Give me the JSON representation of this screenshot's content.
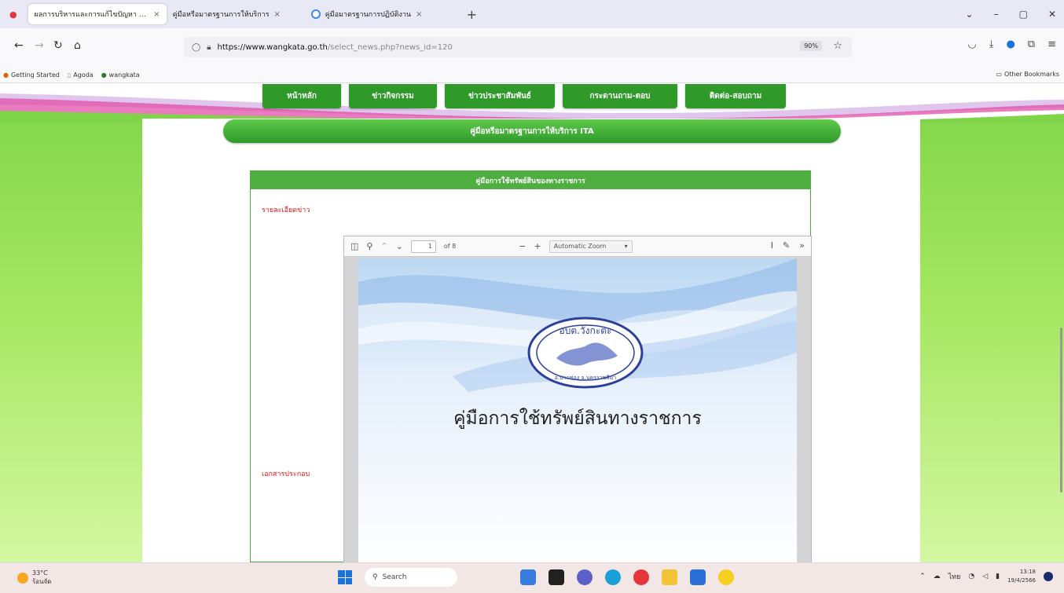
{
  "browser": {
    "tabs": [
      {
        "title": "ผลการบริหารและการแก้ไขปัญหา อบต.",
        "active": true
      },
      {
        "title": "คู่มือหรือมาตรฐานการให้บริการ",
        "active": false
      },
      {
        "title": "คู่มือมาตรฐานการปฏิบัติงาน",
        "active": false
      }
    ],
    "url_host": "https://www.wangkata.go.th",
    "url_rest": "/select_news.php?news_id=120",
    "zoom": "90%",
    "bookmarks": [
      "Getting Started",
      "Agoda",
      "wangkata"
    ],
    "other_bookmarks": "Other Bookmarks"
  },
  "site": {
    "menu": [
      "หน้าหลัก",
      "ข่าวกิจกรรม",
      "ข่าวประชาสัมพันธ์",
      "กระดานถาม-ตอบ",
      "ติดต่อ-สอบถาม"
    ],
    "banner_title": "คู่มือหรือมาตรฐานการให้บริการ ITA",
    "box_header": "คู่มือการใช้ทรัพย์สินของทางราชการ",
    "details_label": "รายละเอียดข่าว",
    "attachment_label": "เอกสารประกอบ"
  },
  "pdf": {
    "page_input": "1",
    "page_of": "of 8",
    "zoom": "Automatic Zoom",
    "title": "คู่มือการใช้ทรัพย์สินทางราชการ",
    "seal_top": "อบต.วังกะตะ",
    "seal_bottom": "อ.ปากช่อง จ.นครราชสีมา"
  },
  "taskbar": {
    "temp": "33°C",
    "weather": "ร้อนจัด",
    "search": "Search",
    "lang": "ไทย",
    "time": "13:18",
    "date": "19/4/2566"
  }
}
